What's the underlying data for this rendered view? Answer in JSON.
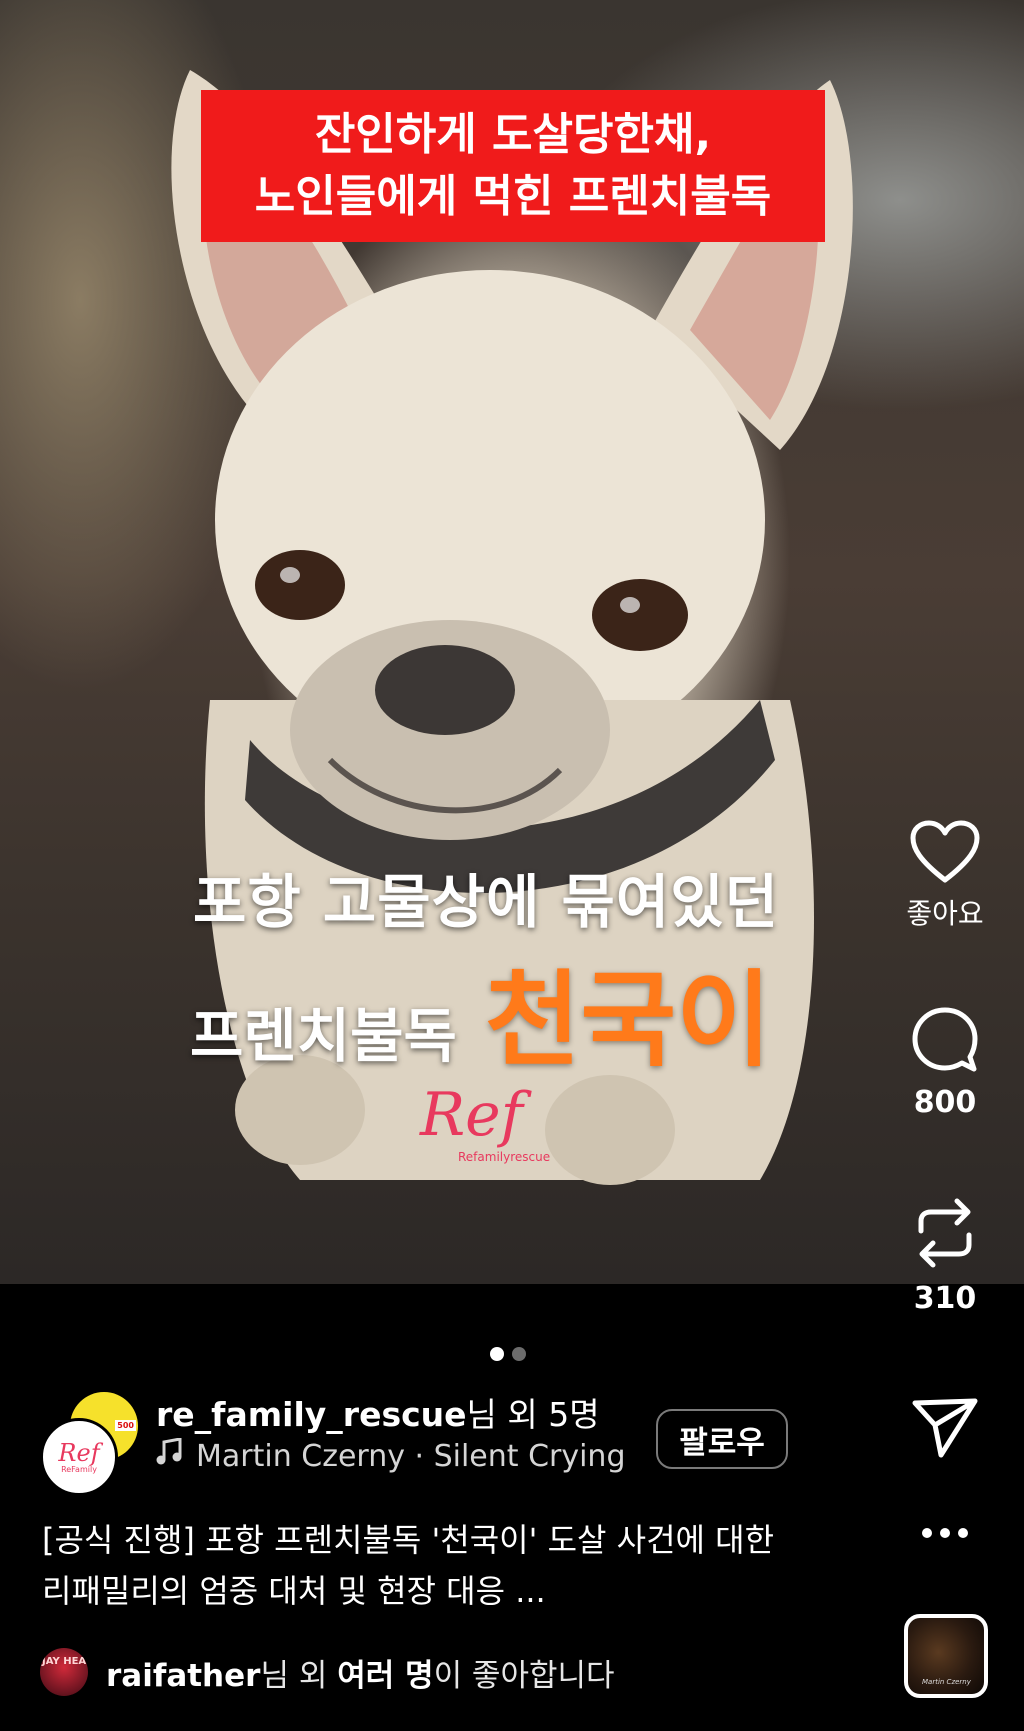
{
  "post": {
    "banner_line1": "잔인하게 도살당한채,",
    "banner_line2": "노인들에게 먹힌 프렌치불독",
    "caption_line1": "포항 고물상에 묶여있던",
    "caption_line2_a": "프렌치불독",
    "caption_line2_b": "천국이",
    "watermark": "Ref",
    "watermark_sub": "Refamilyrescue"
  },
  "rail": {
    "like_label": "좋아요",
    "comment_count": "800",
    "repost_count": "310"
  },
  "carousel": {
    "count": 2,
    "active_index": 0
  },
  "author": {
    "username": "re_family_rescue",
    "suffix": "님 외 5명",
    "avatar_text": "Ref",
    "avatar_sub": "ReFamily",
    "back_avatar_badge": "500"
  },
  "music": {
    "text": "Martin Czerny · Silent Crying"
  },
  "follow_label": "팔로우",
  "caption_text_line1": "[공식 진행] 포항 프렌치불독 '천국이' 도살 사건에 대한",
  "caption_text_line2": "리패밀리의 엄중 대처 및 현장 대응 ...",
  "likes": {
    "avatar_text": "JAY HEA",
    "user": "raifather",
    "mid": "님 외 ",
    "bold": "여러 명",
    "end": "이 좋아합니다"
  },
  "audio_thumb_text": "Martin Czerny",
  "colors": {
    "banner": "#f01b1b",
    "accent_orange": "#ff7a1a",
    "brand_pink": "#e8395e"
  }
}
